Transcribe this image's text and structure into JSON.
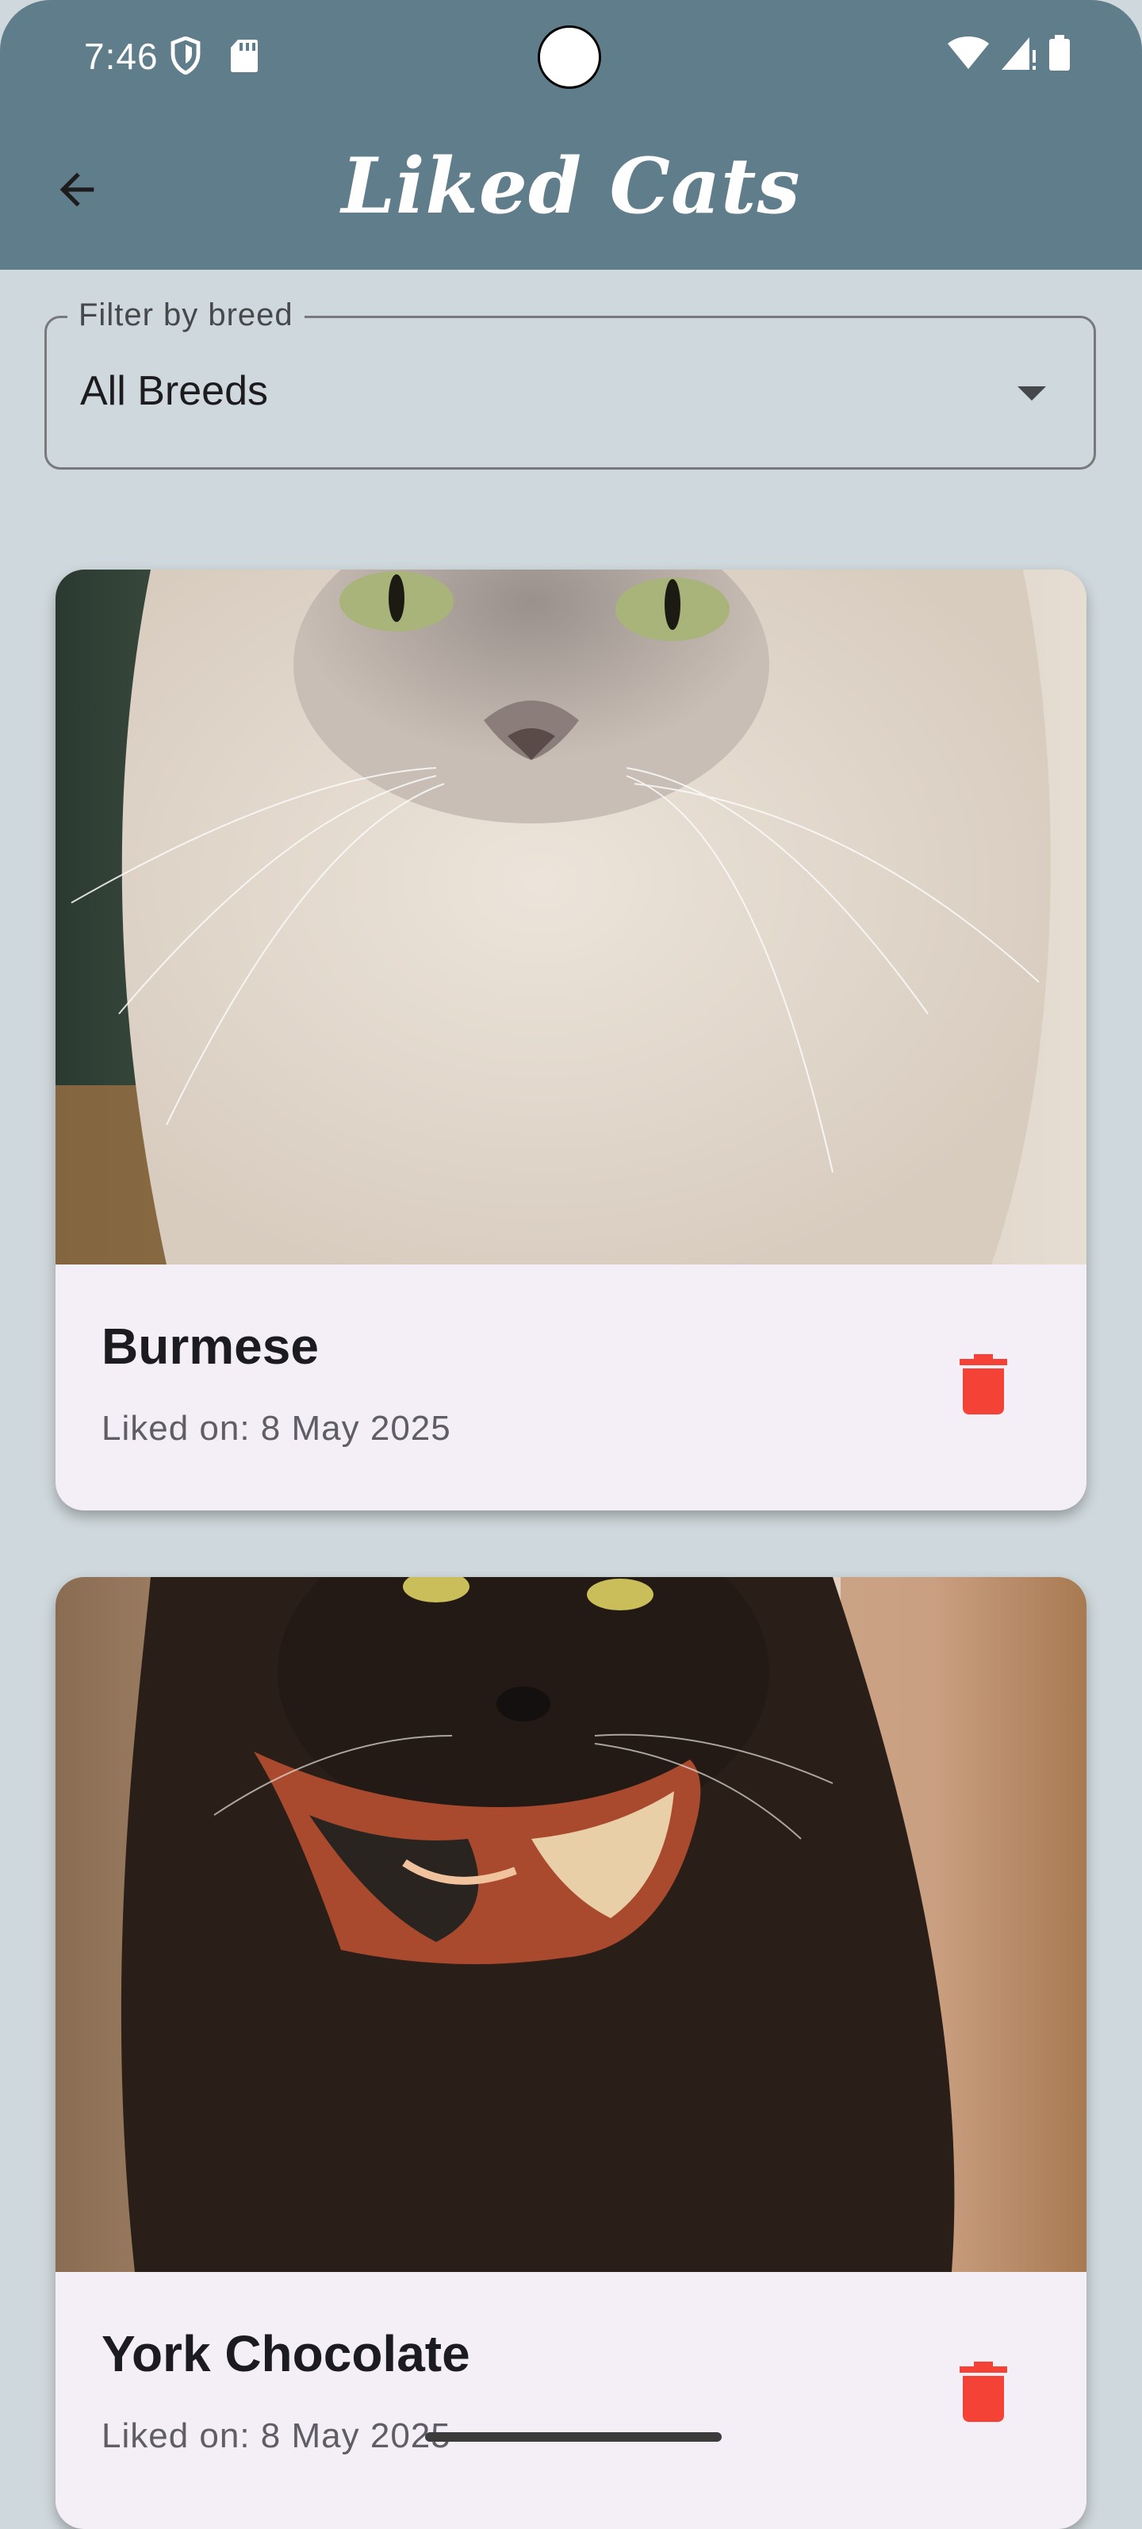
{
  "status_bar": {
    "time": "7:46",
    "left_icons": [
      "shield-icon",
      "sd-card-icon"
    ],
    "right_icons": [
      "wifi-icon",
      "signal-icon",
      "battery-icon"
    ]
  },
  "app_bar": {
    "title": "Liked Cats",
    "back_icon": "arrow-back-icon",
    "color": "#607d8b"
  },
  "filter": {
    "label": "Filter by breed",
    "selected": "All Breeds",
    "dropdown_icon": "dropdown-arrow-icon"
  },
  "cards": [
    {
      "name": "Burmese",
      "liked_on": "Liked on: 8 May 2025",
      "photo": "cream-burmese-cat-photo",
      "delete_icon": "trash-icon"
    },
    {
      "name": "York Chocolate",
      "liked_on": "Liked on: 8 May 2025",
      "photo": "black-cat-with-scarf-photo",
      "delete_icon": "trash-icon"
    }
  ],
  "colors": {
    "background": "#cfd8dc",
    "card": "#f4eff6",
    "delete": "#f44336"
  }
}
